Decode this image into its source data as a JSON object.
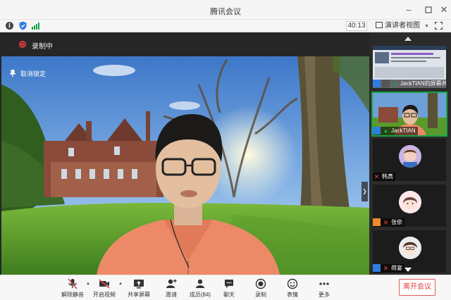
{
  "window": {
    "title": "腾讯会议"
  },
  "infobar": {
    "timer": "40:13",
    "view_mode": "演讲者视图"
  },
  "stage": {
    "recording_label": "录制中",
    "unpin_label": "取消锁定"
  },
  "sidebar": {
    "tiles": [
      {
        "name": "JackTIAN的屏幕共",
        "kind": "screen-share"
      },
      {
        "name": "JackTIAN",
        "kind": "camera",
        "active": true
      },
      {
        "name": "韩真",
        "kind": "avatar"
      },
      {
        "name": "张依",
        "kind": "avatar"
      },
      {
        "name": "荷宴",
        "kind": "avatar"
      }
    ]
  },
  "toolbar": {
    "unmute": "解除静音",
    "start_video": "开启视频",
    "share_screen": "共享屏幕",
    "invite": "邀请",
    "members": "成员(84)",
    "chat": "聊天",
    "record": "录制",
    "reactions": "表情",
    "more": "更多",
    "leave": "离开会议"
  },
  "colors": {
    "accent_green": "#1aa34a",
    "record_red": "#e63b3b",
    "leave_red": "#e04040",
    "muted_red": "#e04848"
  }
}
